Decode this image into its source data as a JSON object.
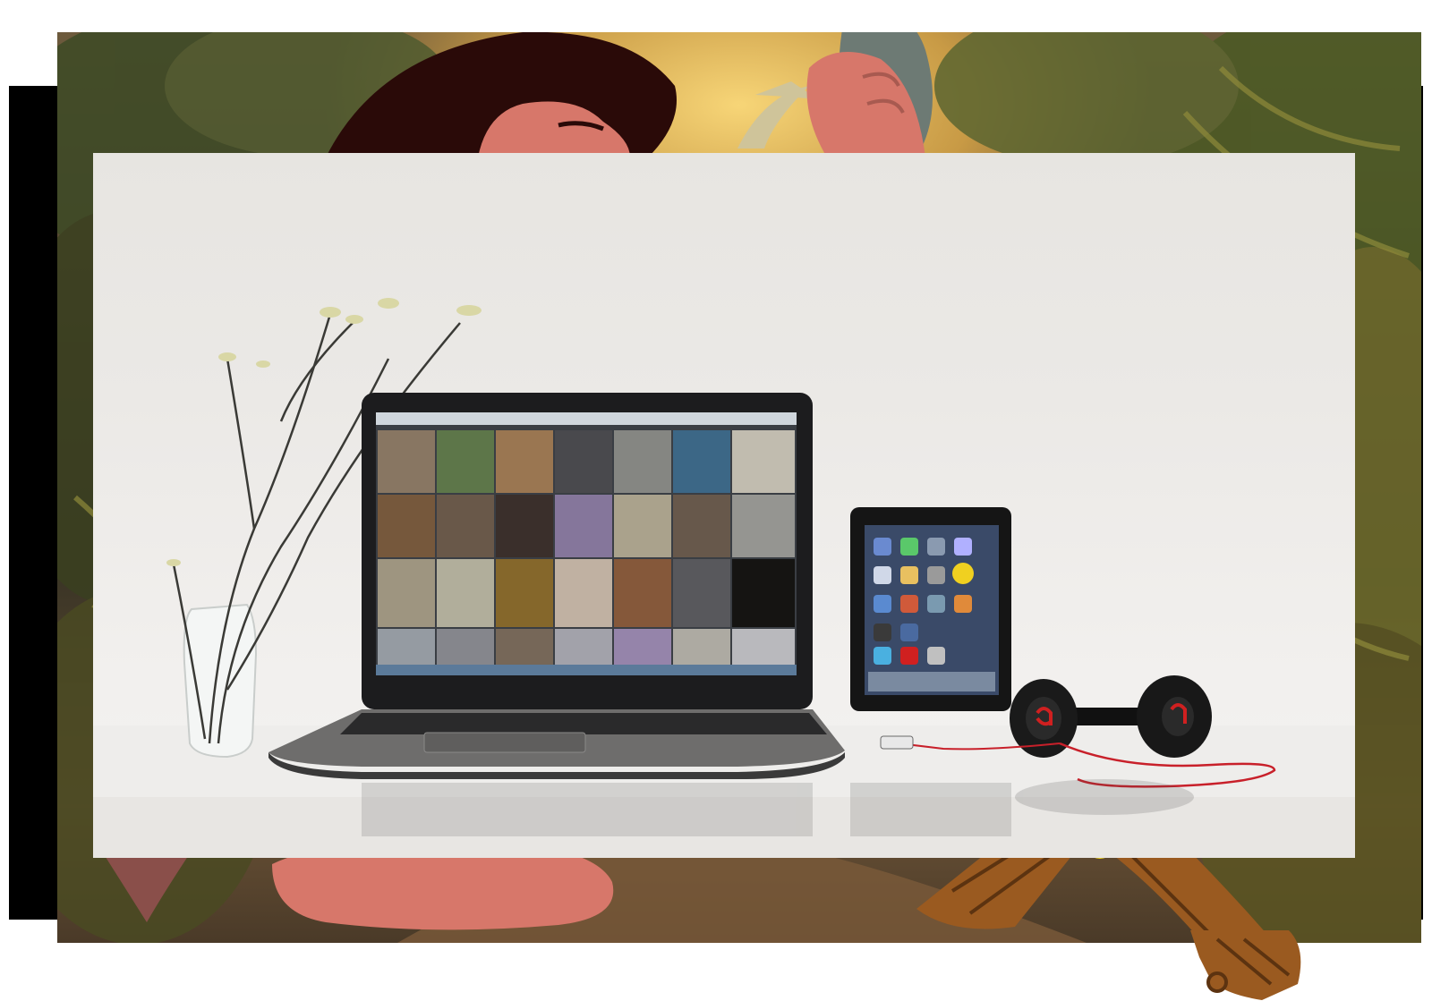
{
  "scene": {
    "background_illustration": "jungle-cartoon-icon",
    "photo": "desk-devices-photo-icon",
    "elements": [
      "plant-vase-icon",
      "laptop-icon",
      "tablet-icon",
      "headphones-icon",
      "cavewoman-figure-icon",
      "pterodactyl-icon",
      "wooden-log-icon"
    ]
  },
  "colors": {
    "frame_black": "#000000",
    "skin": "#d7776a",
    "hair": "#2a0a08",
    "log_brown": "#9a5a20",
    "photo_wall": "#e9e7e4"
  }
}
